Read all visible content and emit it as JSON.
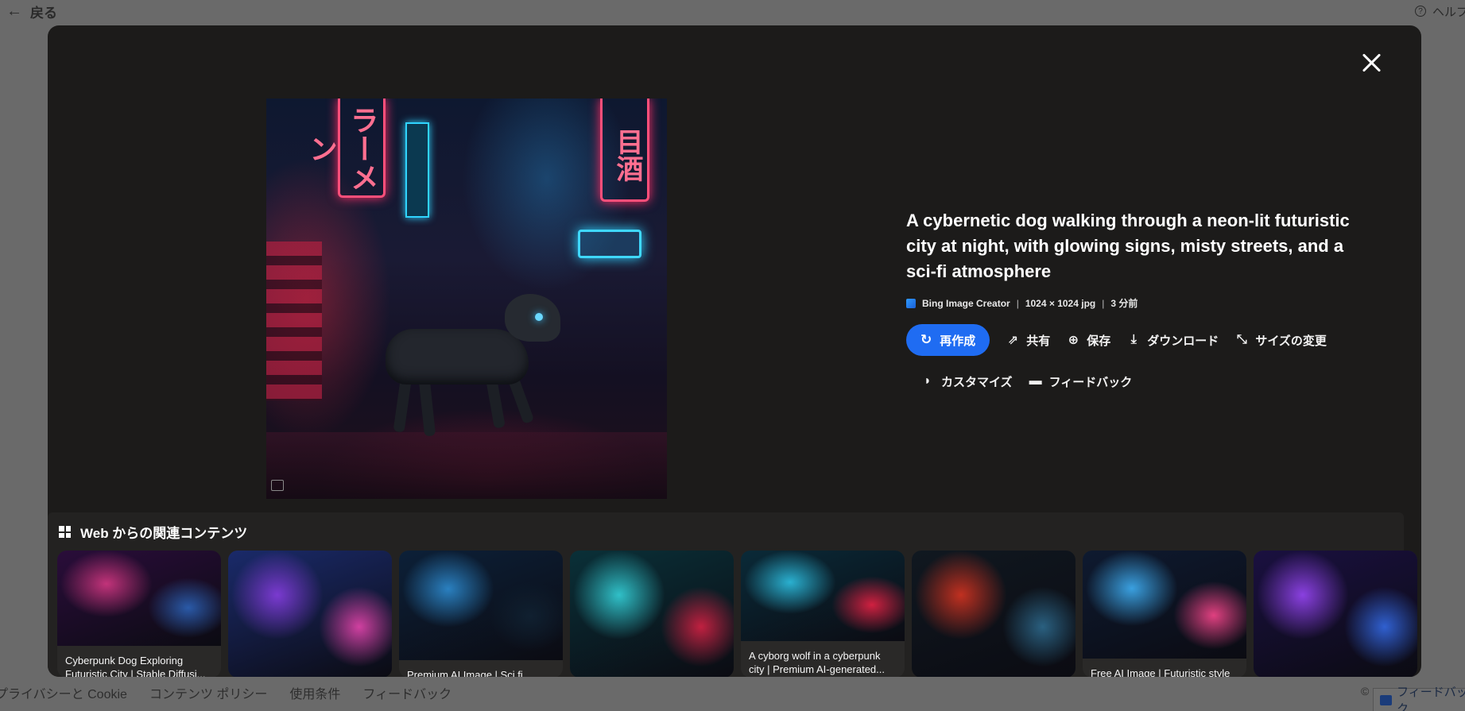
{
  "topbar": {
    "back_label": "戻る",
    "help_label": "ヘルプ"
  },
  "footer": {
    "links": [
      "プライバシーと Cookie",
      "コンテンツ ポリシー",
      "使用条件",
      "フィードバック"
    ],
    "copyright": "©",
    "feedback_button": "フィードバック"
  },
  "modal": {
    "close_icon": "close-icon",
    "image": {
      "sign_left": "ラーメン",
      "sign_right": "目酒"
    },
    "title": "A cybernetic dog walking through a neon-lit futuristic city at night, with glowing signs, misty streets, and a sci-fi atmosphere",
    "meta": {
      "source": "Bing Image Creator",
      "dimensions": "1024 × 1024 jpg",
      "time": "3 分前",
      "separator": "|"
    },
    "actions": {
      "recreate": "再作成",
      "share": "共有",
      "save": "保存",
      "download": "ダウンロード",
      "resize": "サイズの変更",
      "customize": "カスタマイズ",
      "feedback": "フィードバック"
    },
    "related": {
      "header": "Web からの関連コンテンツ",
      "cards": [
        {
          "caption": "Cyberpunk Dog Exploring Futuristic City | Stable Diffusi...",
          "colors": [
            "#2a0d3a",
            "#c2337a",
            "#2a5aa8"
          ]
        },
        {
          "caption": "",
          "colors": [
            "#1a2a6a",
            "#7a3ad0",
            "#d040a0"
          ]
        },
        {
          "caption": "Premium AI Image | Sci fi",
          "colors": [
            "#0c2038",
            "#2a80c0",
            "#102030"
          ]
        },
        {
          "caption": "",
          "colors": [
            "#0a3038",
            "#30c0c8",
            "#c02040"
          ]
        },
        {
          "caption": "A cyborg wolf in a cyberpunk city | Premium AI-generated...",
          "colors": [
            "#0a2a38",
            "#2ab0d0",
            "#d02040"
          ]
        },
        {
          "caption": "",
          "colors": [
            "#101820",
            "#c03020",
            "#2a6080"
          ]
        },
        {
          "caption": "Free AI Image | Futuristic style",
          "colors": [
            "#0e1a30",
            "#3aa0e0",
            "#e04080"
          ]
        },
        {
          "caption": "",
          "colors": [
            "#1a1040",
            "#8a40e0",
            "#3060d0"
          ]
        }
      ]
    }
  }
}
